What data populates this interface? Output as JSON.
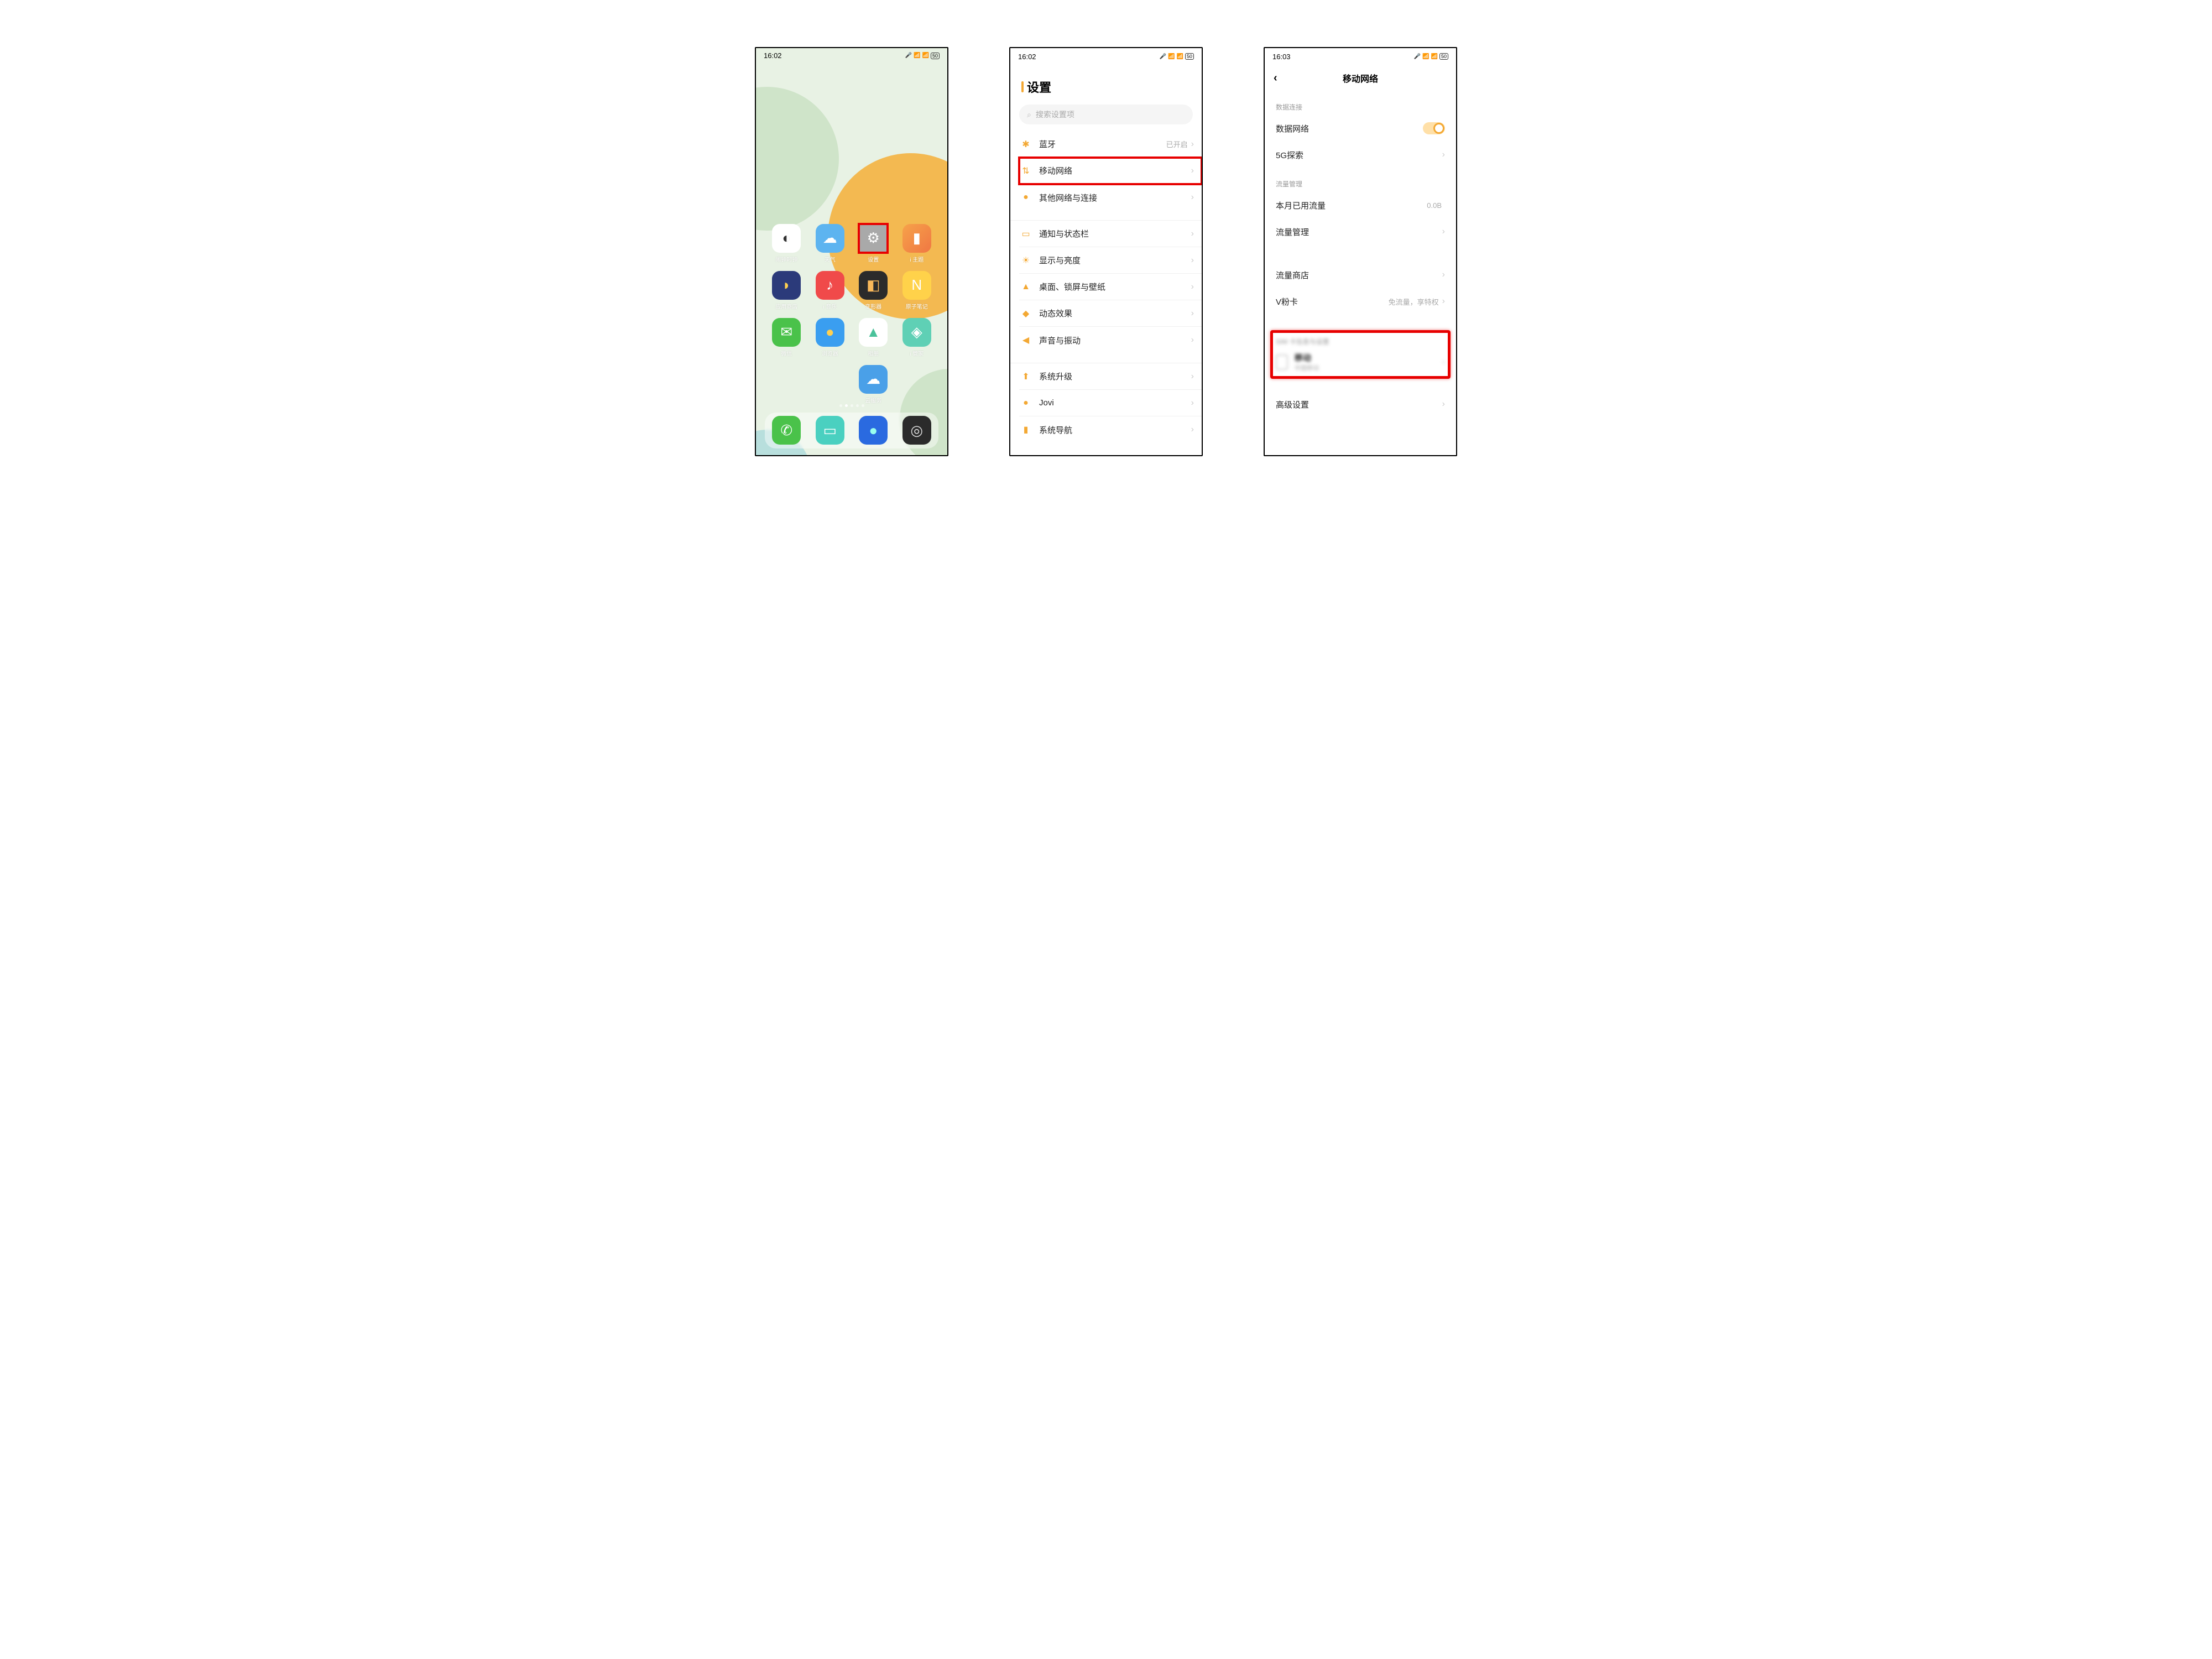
{
  "screen1": {
    "time": "16:02",
    "battery": "50",
    "apps_row1": [
      {
        "label": "闹钟时钟",
        "name": "alarm-clock",
        "bg": "#fff",
        "glyph": "◐",
        "glyphColor": "#333"
      },
      {
        "label": "天气",
        "name": "weather",
        "bg": "#5db4f0",
        "glyph": "☁",
        "glyphColor": "#fff"
      },
      {
        "label": "设置",
        "name": "settings",
        "bg": "#a9a9a9",
        "glyph": "⚙",
        "glyphColor": "#fff",
        "hl": true
      },
      {
        "label": "i 主题",
        "name": "theme",
        "bg": "linear-gradient(135deg,#f6a24a,#f07743)",
        "glyph": "▮",
        "glyphColor": "#fff"
      }
    ],
    "apps_row2": [
      {
        "label": "应用商店",
        "name": "appstore",
        "bg": "#2b3a7a",
        "glyph": "◗",
        "glyphColor": "#ffd050"
      },
      {
        "label": "i 音乐",
        "name": "music",
        "bg": "#f04a4a",
        "glyph": "♪",
        "glyphColor": "#fff"
      },
      {
        "label": "变形器",
        "name": "transformer",
        "bg": "#2b2b2b",
        "glyph": "◧",
        "glyphColor": "#f8b85a"
      },
      {
        "label": "原子笔记",
        "name": "notes",
        "bg": "#ffd24a",
        "glyph": "N",
        "glyphColor": "#fff"
      }
    ],
    "apps_row3": [
      {
        "label": "微信",
        "name": "wechat",
        "bg": "#4ac24a",
        "glyph": "✉",
        "glyphColor": "#fff"
      },
      {
        "label": "浏览器",
        "name": "browser",
        "bg": "#3a9ef0",
        "glyph": "●",
        "glyphColor": "#ffd050"
      },
      {
        "label": "相册",
        "name": "gallery",
        "bg": "#fff",
        "glyph": "▲",
        "glyphColor": "#4ac29a"
      },
      {
        "label": "i 管家",
        "name": "manager",
        "bg": "#5fd0b5",
        "glyph": "◈",
        "glyphColor": "#fff"
      }
    ],
    "apps_row4": [
      {
        "label": "",
        "name": "blank1",
        "blank": true
      },
      {
        "label": "",
        "name": "blank2",
        "blank": true
      },
      {
        "label": "云服务",
        "name": "cloud",
        "bg": "#4aa0e8",
        "glyph": "☁",
        "glyphColor": "#fff"
      },
      {
        "label": "",
        "name": "blank3",
        "blank": true
      }
    ],
    "dock": [
      {
        "name": "phone",
        "bg": "#4ac24a",
        "glyph": "✆",
        "glyphColor": "#fff"
      },
      {
        "name": "messages",
        "bg": "#4ad0c0",
        "glyph": "▭",
        "glyphColor": "#fff"
      },
      {
        "name": "web",
        "bg": "#2a6ae0",
        "glyph": "●",
        "glyphColor": "#9fe"
      },
      {
        "name": "camera",
        "bg": "#2b2b2b",
        "glyph": "◎",
        "glyphColor": "#ddd"
      }
    ]
  },
  "screen2": {
    "time": "16:02",
    "battery": "50",
    "title": "设置",
    "search_placeholder": "搜索设置项",
    "rows_g1": [
      {
        "icon": "✱",
        "ic": "#f3a833",
        "label": "蓝牙",
        "val": "已开启"
      },
      {
        "icon": "⇅",
        "ic": "#f3a833",
        "label": "移动网络",
        "hl": true
      },
      {
        "icon": "●",
        "ic": "#f3a833",
        "label": "其他网络与连接"
      }
    ],
    "rows_g2": [
      {
        "icon": "▭",
        "ic": "#f3a833",
        "label": "通知与状态栏"
      },
      {
        "icon": "☀",
        "ic": "#f3a833",
        "label": "显示与亮度"
      },
      {
        "icon": "▲",
        "ic": "#f3a833",
        "label": "桌面、锁屏与壁纸"
      },
      {
        "icon": "◆",
        "ic": "#f3a833",
        "label": "动态效果"
      },
      {
        "icon": "◀",
        "ic": "#f3a833",
        "label": "声音与振动"
      }
    ],
    "rows_g3": [
      {
        "icon": "⬆",
        "ic": "#f3a833",
        "label": "系统升级"
      },
      {
        "icon": "●",
        "ic": "#f3a833",
        "label": "Jovi"
      },
      {
        "icon": "▮",
        "ic": "#f3a833",
        "label": "系统导航"
      }
    ]
  },
  "screen3": {
    "time": "16:03",
    "battery": "50",
    "title": "移动网络",
    "sec1": "数据连接",
    "data_network": "数据网络",
    "five_g": "5G探索",
    "sec2": "流量管理",
    "month_usage": "本月已用流量",
    "month_usage_val": "0.0B",
    "traffic_mgmt": "流量管理",
    "traffic_shop": "流量商店",
    "vcard": "V粉卡",
    "vcard_sub": "免流量，享特权",
    "sim_sec_header": "SIM 卡信息与设置",
    "sim_name": "移动",
    "sim_sub": "中国移动",
    "advanced": "高级设置"
  }
}
